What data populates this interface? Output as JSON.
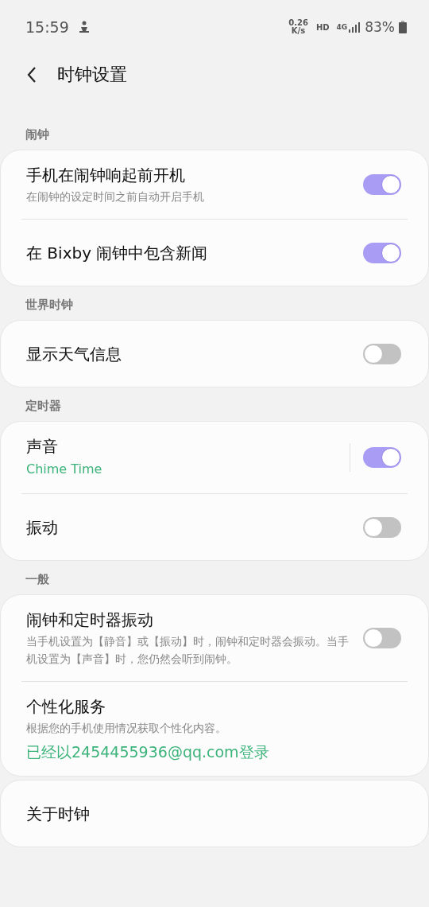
{
  "status_bar": {
    "time": "15:59",
    "speed": "0.26",
    "speed_unit": "K/s",
    "hd": "HD",
    "network": "4G",
    "battery": "83%"
  },
  "header": {
    "title": "时钟设置"
  },
  "sections": [
    {
      "heading": "闹钟",
      "items": [
        {
          "kind": "toggle",
          "title": "手机在闹钟响起前开机",
          "description": "在闹钟的设定时间之前自动开启手机",
          "on": true
        },
        {
          "kind": "toggle",
          "title": "在 Bixby 闹钟中包含新闻",
          "on": true
        }
      ]
    },
    {
      "heading": "世界时钟",
      "items": [
        {
          "kind": "toggle",
          "title": "显示天气信息",
          "on": false
        }
      ]
    },
    {
      "heading": "定时器",
      "items": [
        {
          "kind": "split_toggle",
          "title": "声音",
          "value": "Chime Time",
          "on": true
        },
        {
          "kind": "toggle",
          "title": "振动",
          "on": false
        }
      ]
    },
    {
      "heading": "一般",
      "items": [
        {
          "kind": "toggle",
          "title": "闹钟和定时器振动",
          "description": "当手机设置为【静音】或【振动】时，闹钟和定时器会振动。当手机设置为【声音】时，您仍然会听到闹钟。",
          "on": false
        },
        {
          "kind": "plain",
          "title": "个性化服务",
          "description": "根据您的手机使用情况获取个性化内容。",
          "value": "已经以2454455936@qq.com登录"
        }
      ]
    },
    {
      "items": [
        {
          "kind": "plain",
          "title": "关于时钟"
        }
      ]
    }
  ]
}
